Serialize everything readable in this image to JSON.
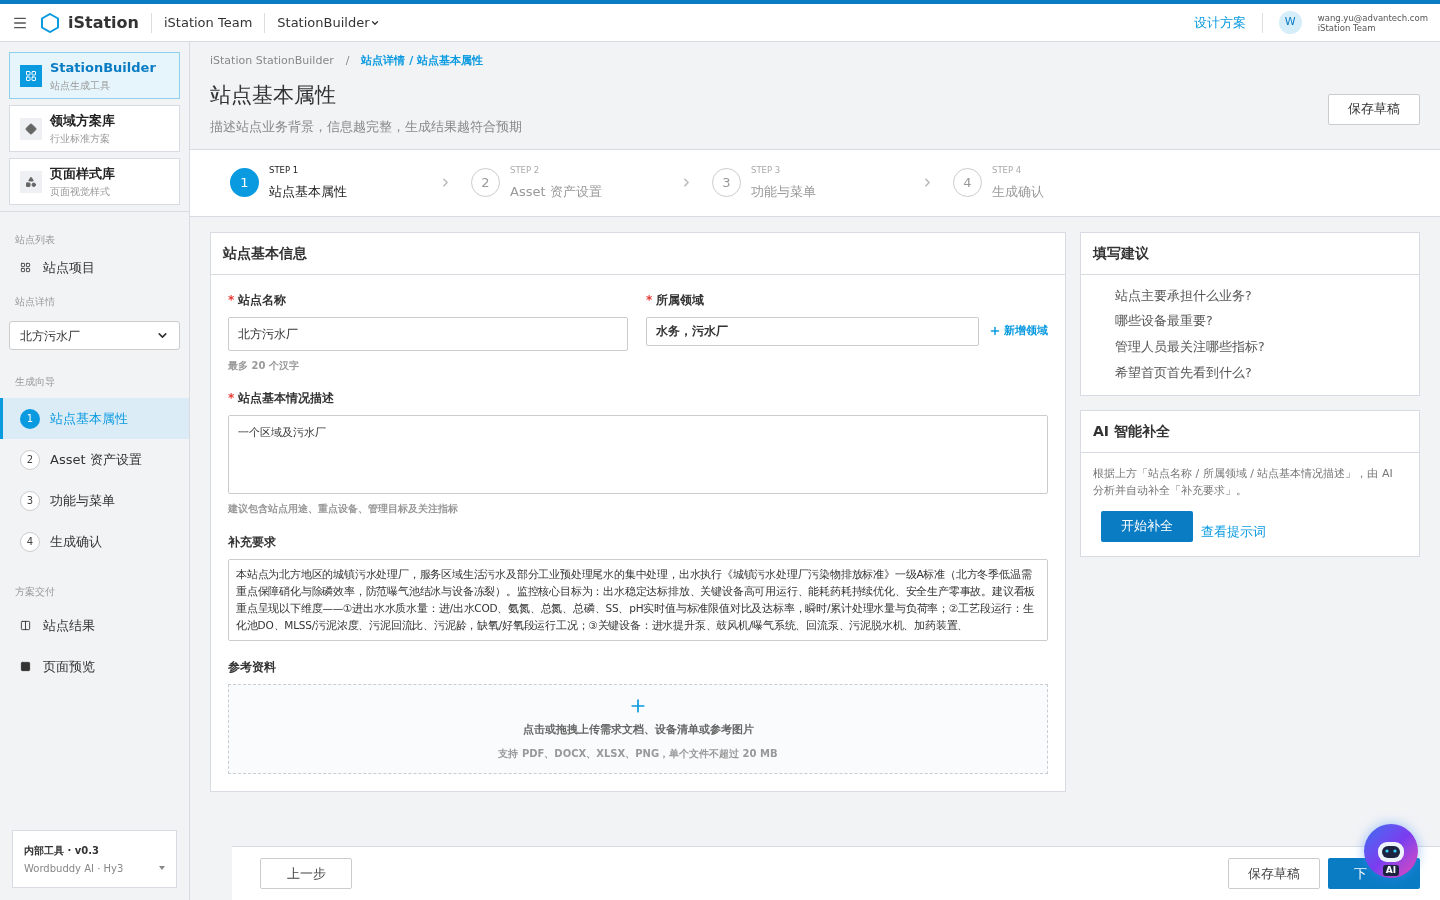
{
  "header": {
    "brand": "iStation",
    "team": "iStation Team",
    "app_menu": "StationBuilder",
    "design_link": "设计方案",
    "avatar": "W",
    "user_email": "wang.yu@advantech.com",
    "user_team": "iStation Team"
  },
  "sidebar": {
    "tools": [
      {
        "title": "StationBuilder",
        "subtitle": "站点生成工具",
        "selected": true,
        "kind": "grid"
      },
      {
        "title": "领域方案库",
        "subtitle": "行业标准方案",
        "selected": false,
        "kind": "diamond"
      },
      {
        "title": "页面样式库",
        "subtitle": "页面视觉样式",
        "selected": false,
        "kind": "diamonds"
      }
    ],
    "list_heading": "站点列表",
    "list_item": "站点项目",
    "detail_heading": "站点详情",
    "site_select": "北方污水厂",
    "wizard_heading": "生成向导",
    "wizard": [
      {
        "number": "1",
        "label": "站点基本属性",
        "selected": true
      },
      {
        "number": "2",
        "label": "Asset 资产设置",
        "selected": false
      },
      {
        "number": "3",
        "label": "功能与菜单",
        "selected": false
      },
      {
        "number": "4",
        "label": "生成确认",
        "selected": false
      }
    ],
    "delivery_heading": "方案交付",
    "delivery": [
      {
        "label": "站点结果",
        "kind": "columns"
      },
      {
        "label": "页面预览",
        "kind": "square"
      }
    ],
    "footer": {
      "title": "内部工具 · v0.3",
      "model": "Wordbuddy AI · Hy3"
    }
  },
  "breadcrumb": {
    "root": "iStation StationBuilder",
    "separator": "/",
    "current": "站点详情 / 站点基本属性"
  },
  "page": {
    "title": "站点基本属性",
    "subtitle": "描述站点业务背景，信息越完整，生成结果越符合预期",
    "save_button": "保存草稿"
  },
  "steps": [
    {
      "step": "STEP 1",
      "number": "1",
      "label": "站点基本属性",
      "selected": true
    },
    {
      "step": "STEP 2",
      "number": "2",
      "label": "Asset 资产设置",
      "selected": false
    },
    {
      "step": "STEP 3",
      "number": "3",
      "label": "功能与菜单",
      "selected": false
    },
    {
      "step": "STEP 4",
      "number": "4",
      "label": "生成确认",
      "selected": false
    }
  ],
  "form": {
    "title": "站点基本信息",
    "required_mark": "*",
    "name": {
      "label": "站点名称",
      "required": true,
      "value": "北方污水厂",
      "hint": "最多 20 个汉字"
    },
    "domain": {
      "label": "所属领域",
      "required": true,
      "value": "水务，污水厂",
      "add_link": "新增领域"
    },
    "description": {
      "label": "站点基本情况描述",
      "required": true,
      "value": "一个区域及污水厂",
      "hint": "建议包含站点用途、重点设备、管理目标及关注指标"
    },
    "supplement": {
      "label": "补充要求",
      "required": false,
      "value": "本站点为北方地区的城镇污水处理厂，服务区域生活污水及部分工业预处理尾水的集中处理，出水执行《城镇污水处理厂污染物排放标准》一级A标准（北方冬季低温需重点保障硝化与除磷效率，防范曝气池结冰与设备冻裂）。监控核心目标为：出水稳定达标排放、关键设备高可用运行、能耗药耗持续优化、安全生产零事故。建议看板重点呈现以下维度——①进出水水质水量：进/出水COD、氨氮、总氮、总磷、SS、pH实时值与标准限值对比及达标率，瞬时/累计处理水量与负荷率；②工艺段运行：生化池DO、MLSS/污泥浓度、污泥回流比、污泥龄，缺氧/好氧段运行工况；③关键设备：进水提升泵、鼓风机/曝气系统、回流泵、污泥脱水机、加药装置、"
    },
    "references": {
      "label": "参考资料",
      "required": false,
      "upload_text": "点击或拖拽上传需求文档、设备清单或参考图片",
      "upload_hint": "支持 PDF、DOCX、XLSX、PNG，单个文件不超过 20 MB"
    }
  },
  "tips": {
    "title": "填写建议",
    "items": [
      "站点主要承担什么业务?",
      "哪些设备最重要?",
      "管理人员最关注哪些指标?",
      "希望首页首先看到什么?"
    ]
  },
  "ai": {
    "title": "AI 智能补全",
    "text": "根据上方「站点名称 / 所属领域 / 站点基本情况描述」，由 AI 分析并自动补全「补充要求」。",
    "start_button": "开始补全",
    "prompt_link": "查看提示词"
  },
  "footer": {
    "back_button": "上一步",
    "save_button": "保存草稿",
    "next_button": "下",
    "assistant_badge": "AI"
  }
}
